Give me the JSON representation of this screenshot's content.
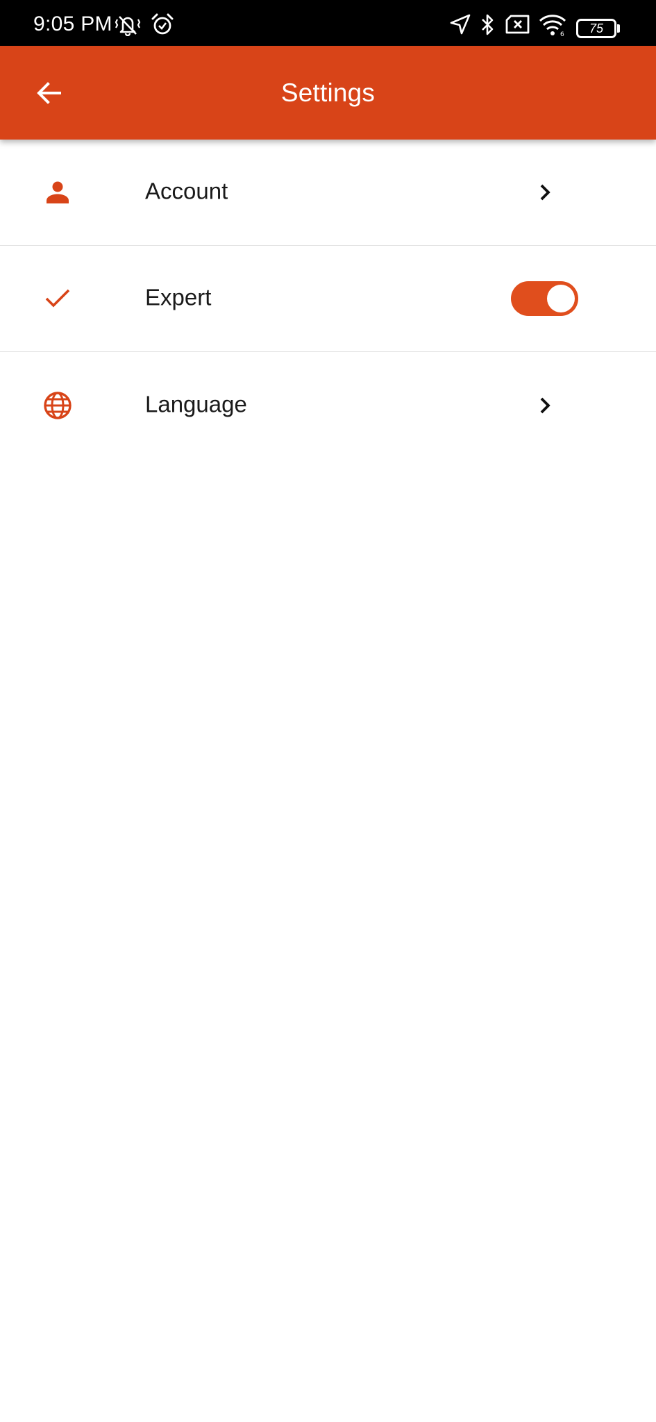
{
  "status_bar": {
    "time": "9:05 PM",
    "battery": "75",
    "icons": [
      "vibrate-icon",
      "alarm-icon",
      "location-icon",
      "bluetooth-icon",
      "no-sim-icon",
      "wifi-icon",
      "battery-icon"
    ]
  },
  "app_bar": {
    "title": "Settings",
    "back_icon": "arrow-back-icon"
  },
  "settings": {
    "items": [
      {
        "label": "Account",
        "icon": "person-icon",
        "trailing": "chevron-right-icon"
      },
      {
        "label": "Expert",
        "icon": "check-icon",
        "trailing": "toggle",
        "toggle_on": true
      },
      {
        "label": "Language",
        "icon": "globe-icon",
        "trailing": "chevron-right-icon"
      }
    ]
  },
  "colors": {
    "accent": "#d84418",
    "toggle_track": "#e04e1d",
    "background": "#ffffff",
    "status_bar": "#000000",
    "divider": "#e2e2e2"
  }
}
